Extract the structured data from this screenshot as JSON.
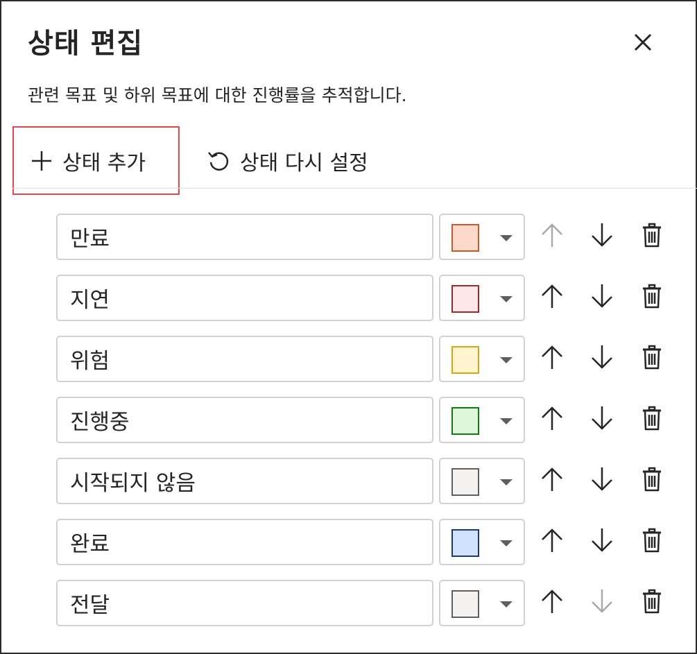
{
  "dialog": {
    "title": "상태 편집",
    "subtitle": "관련 목표 및 하위 목표에 대한 진행률을 추적합니다.",
    "close_icon": "close-icon"
  },
  "toolbar": {
    "add_label": "상태 추가",
    "add_icon": "plus-icon",
    "reset_label": "상태 다시 설정",
    "reset_icon": "undo-icon",
    "highlight_color": "#e0484e"
  },
  "statuses": [
    {
      "name": "만료",
      "fill": "#fdd9cc",
      "border": "#c8592b",
      "up_enabled": false,
      "down_enabled": true
    },
    {
      "name": "지연",
      "fill": "#fde7e9",
      "border": "#a4262c",
      "up_enabled": true,
      "down_enabled": true
    },
    {
      "name": "위험",
      "fill": "#fff4ce",
      "border": "#d1a80f",
      "up_enabled": true,
      "down_enabled": true
    },
    {
      "name": "진행중",
      "fill": "#dff6dd",
      "border": "#107c10",
      "up_enabled": true,
      "down_enabled": true
    },
    {
      "name": "시작되지 않음",
      "fill": "#f3f2f1",
      "border": "#605e5c",
      "up_enabled": true,
      "down_enabled": true
    },
    {
      "name": "완료",
      "fill": "#cfe2ff",
      "border": "#1b3a6b",
      "up_enabled": true,
      "down_enabled": true
    },
    {
      "name": "전달",
      "fill": "#f3f2f1",
      "border": "#605e5c",
      "up_enabled": true,
      "down_enabled": false
    }
  ],
  "row_icons": {
    "up": "arrow-up-icon",
    "down": "arrow-down-icon",
    "delete": "trash-icon",
    "dropdown": "chevron-down-icon"
  },
  "colors": {
    "enabled_icon": "#242424",
    "disabled_icon": "#a8a8a8"
  }
}
